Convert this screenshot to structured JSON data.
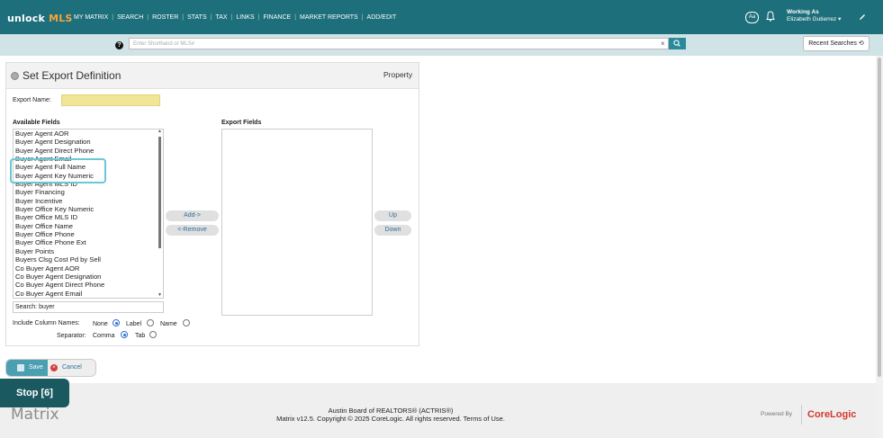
{
  "brand": {
    "unlock": "unlock",
    "mls": "MLS",
    "matrix": "Matrix",
    "matrix_tm": "™"
  },
  "nav": {
    "items": [
      "MY MATRIX",
      "SEARCH",
      "ROSTER",
      "STATS",
      "TAX",
      "LINKS",
      "FINANCE",
      "MARKET REPORTS",
      "ADD/EDIT"
    ]
  },
  "header": {
    "aa": "Aa",
    "working_as_title": "Working As",
    "working_as_user": "Elizabeth Gutierrez"
  },
  "search": {
    "placeholder": "Enter Shorthand or MLS#",
    "help": "?",
    "clear": "×",
    "recent_label": "Recent Searches"
  },
  "panel": {
    "title": "Set Export Definition",
    "property": "Property",
    "export_name_label": "Export Name:",
    "export_name_value": "",
    "available_label": "Available Fields",
    "export_label": "Export Fields",
    "available_fields": [
      "Buyer Agent AOR",
      "Buyer Agent Designation",
      "Buyer Agent Direct Phone",
      "Buyer Agent Email",
      "Buyer Agent Full Name",
      "Buyer Agent Key Numeric",
      "Buyer Agent MLS ID",
      "Buyer Financing",
      "Buyer Incentive",
      "Buyer Office Key Numeric",
      "Buyer Office MLS ID",
      "Buyer Office Name",
      "Buyer Office Phone",
      "Buyer Office Phone Ext",
      "Buyer Points",
      "Buyers Clsg Cost Pd by Sell",
      "Co Buyer Agent AOR",
      "Co Buyer Agent Designation",
      "Co Buyer Agent Direct Phone",
      "Co Buyer Agent Email"
    ],
    "add_label": "Add->",
    "remove_label": "<-Remove",
    "up_label": "Up",
    "down_label": "Down",
    "search_label": "Search:",
    "search_value": "buyer",
    "include_label": "Include Column Names:",
    "opt_none": "None",
    "opt_label": "Label",
    "opt_name": "Name",
    "separator_label": "Separator:",
    "opt_comma": "Comma",
    "opt_tab": "Tab",
    "include_selected": "None",
    "separator_selected": "Comma"
  },
  "actions": {
    "save": "Save",
    "cancel": "Cancel"
  },
  "footer": {
    "line1": "Austin Board of REALTORS® (ACTRIS®)",
    "line2a": "Matrix v12.5. Copyright © 2025 CoreLogic. All rights reserved.",
    "line2b": "Terms of Use.",
    "powered": "Powered By",
    "corelogic": "CoreLogic"
  },
  "overlay": {
    "stop": "Stop [6]"
  },
  "colors": {
    "nav_bg": "#1c6f7b",
    "accent": "#4a9fb0",
    "highlight": "#6ac6d8",
    "field_yellow": "#f1e597"
  }
}
